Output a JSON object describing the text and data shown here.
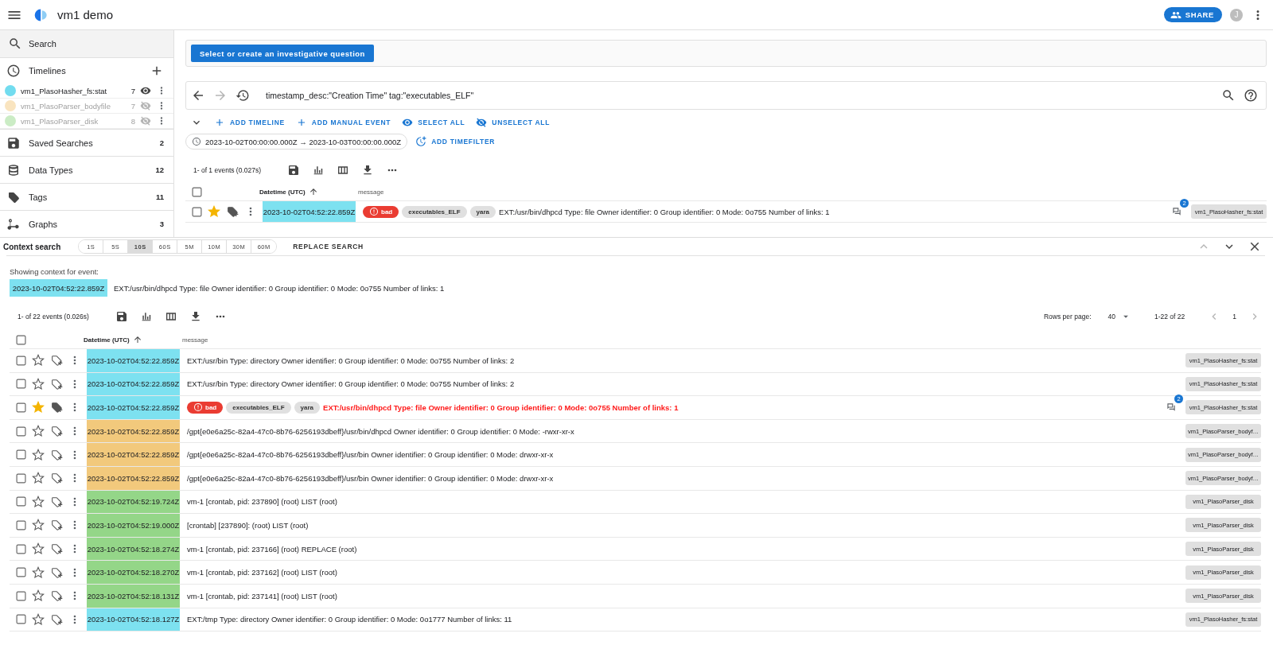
{
  "app_bar": {
    "title": "vm1 demo",
    "share_label": "SHARE",
    "avatar": "J"
  },
  "sidebar": {
    "search_label": "Search",
    "timelines_title": "Timelines",
    "timelines": [
      {
        "name": "vm1_PlasoHasher_fs:stat",
        "count": "7",
        "visible": true,
        "color": "#72dcef"
      },
      {
        "name": "vm1_PlasoParser_bodyfile",
        "count": "7",
        "visible": false,
        "color": "#f9e4bf"
      },
      {
        "name": "vm1_PlasoParser_disk",
        "count": "8",
        "visible": false,
        "color": "#cbecc5"
      }
    ],
    "sections": [
      {
        "label": "Saved Searches",
        "count": "2"
      },
      {
        "label": "Data Types",
        "count": "12"
      },
      {
        "label": "Tags",
        "count": "11"
      },
      {
        "label": "Graphs",
        "count": "3"
      }
    ]
  },
  "question": {
    "button_label": "Select or create an investigative question"
  },
  "search": {
    "query": "timestamp_desc:\"Creation Time\" tag:\"executables_ELF\""
  },
  "actions": [
    "ADD TIMELINE",
    "ADD MANUAL EVENT",
    "SELECT ALL",
    "UNSELECT ALL"
  ],
  "time_filter": {
    "range": "2023-10-02T00:00:00.000Z → 2023-10-03T00:00:00.000Z",
    "add_label": "ADD TIMEFILTER"
  },
  "results": {
    "summary": "1- of 1 events (0.027s)",
    "select_all_checked": false,
    "columns": [
      "Datetime (UTC)",
      "message"
    ],
    "rows": [
      {
        "checked": false,
        "starred": true,
        "datetime": "2023-10-02T04:52:22.859Z",
        "color": "#7de1f0",
        "tags": [
          {
            "label": "bad",
            "kind": "alert"
          },
          {
            "label": "executables_ELF",
            "kind": "label"
          },
          {
            "label": "yara",
            "kind": "label"
          }
        ],
        "message": "EXT:/usr/bin/dhpcd Type: file Owner identifier: 0 Group identifier: 0 Mode: 0o755 Number of links: 1",
        "highlighted": false,
        "comments": "2",
        "timeline": "vm1_PlasoHasher_fs:stat"
      }
    ]
  },
  "context": {
    "title": "Context search",
    "intervals": [
      {
        "label": "1S",
        "selected": false
      },
      {
        "label": "5S",
        "selected": false
      },
      {
        "label": "10S",
        "selected": true
      },
      {
        "label": "60S",
        "selected": false
      },
      {
        "label": "5M",
        "selected": false
      },
      {
        "label": "10M",
        "selected": false
      },
      {
        "label": "30M",
        "selected": false
      },
      {
        "label": "60M",
        "selected": false
      }
    ],
    "replace_label": "REPLACE SEARCH",
    "showing_label": "Showing context for event:",
    "event": {
      "datetime": "2023-10-02T04:52:22.859Z",
      "color": "#7de1f0",
      "message": "EXT:/usr/bin/dhpcd Type: file Owner identifier: 0 Group identifier: 0 Mode: 0o755 Number of links: 1"
    },
    "summary": "1- of 22 events (0.026s)",
    "select_all_checked": false,
    "rows_per_page_label": "Rows per page:",
    "rows_per_page": "40",
    "range": "1-22 of 22",
    "page": "1",
    "columns": [
      "Datetime (UTC)",
      "message"
    ],
    "rows": [
      {
        "checked": false,
        "starred": false,
        "datetime": "2023-10-02T04:52:22.859Z",
        "color": "#7de1f0",
        "tags": [],
        "message": "EXT:/usr/bin Type: directory Owner identifier: 0 Group identifier: 0 Mode: 0o755 Number of links: 2",
        "highlighted": false,
        "timeline": "vm1_PlasoHasher_fs:stat"
      },
      {
        "checked": false,
        "starred": false,
        "datetime": "2023-10-02T04:52:22.859Z",
        "color": "#7de1f0",
        "tags": [],
        "message": "EXT:/usr/bin Type: directory Owner identifier: 0 Group identifier: 0 Mode: 0o755 Number of links: 2",
        "highlighted": false,
        "timeline": "vm1_PlasoHasher_fs:stat"
      },
      {
        "checked": false,
        "starred": true,
        "datetime": "2023-10-02T04:52:22.859Z",
        "color": "#7de1f0",
        "tags": [
          {
            "label": "bad",
            "kind": "alert"
          },
          {
            "label": "executables_ELF",
            "kind": "label"
          },
          {
            "label": "yara",
            "kind": "label"
          }
        ],
        "message": "EXT:/usr/bin/dhpcd Type: file Owner identifier: 0 Group identifier: 0 Mode: 0o755 Number of links: 1",
        "highlighted": true,
        "comments": "2",
        "timeline": "vm1_PlasoHasher_fs:stat"
      },
      {
        "checked": false,
        "starred": false,
        "datetime": "2023-10-02T04:52:22.859Z",
        "color": "#f2c97c",
        "tags": [],
        "message": "/gpt{e0e6a25c-82a4-47c0-8b76-6256193dbeff}/usr/bin/dhpcd Owner identifier: 0 Group identifier: 0 Mode: -rwxr-xr-x",
        "highlighted": false,
        "timeline": "vm1_PlasoParser_bodyf…"
      },
      {
        "checked": false,
        "starred": false,
        "datetime": "2023-10-02T04:52:22.859Z",
        "color": "#f2c97c",
        "tags": [],
        "message": "/gpt{e0e6a25c-82a4-47c0-8b76-6256193dbeff}/usr/bin Owner identifier: 0 Group identifier: 0 Mode: drwxr-xr-x",
        "highlighted": false,
        "timeline": "vm1_PlasoParser_bodyf…"
      },
      {
        "checked": false,
        "starred": false,
        "datetime": "2023-10-02T04:52:22.859Z",
        "color": "#f2c97c",
        "tags": [],
        "message": "/gpt{e0e6a25c-82a4-47c0-8b76-6256193dbeff}/usr/bin Owner identifier: 0 Group identifier: 0 Mode: drwxr-xr-x",
        "highlighted": false,
        "timeline": "vm1_PlasoParser_bodyf…"
      },
      {
        "checked": false,
        "starred": false,
        "datetime": "2023-10-02T04:52:19.724Z",
        "color": "#94d688",
        "tags": [],
        "message": "vm-1 [crontab, pid: 237890] (root) LIST (root)",
        "highlighted": false,
        "timeline": "vm1_PlasoParser_disk"
      },
      {
        "checked": false,
        "starred": false,
        "datetime": "2023-10-02T04:52:19.000Z",
        "color": "#94d688",
        "tags": [],
        "message": "[crontab] [237890]: (root) LIST (root)",
        "highlighted": false,
        "timeline": "vm1_PlasoParser_disk"
      },
      {
        "checked": false,
        "starred": false,
        "datetime": "2023-10-02T04:52:18.274Z",
        "color": "#94d688",
        "tags": [],
        "message": "vm-1 [crontab, pid: 237166] (root) REPLACE (root)",
        "highlighted": false,
        "timeline": "vm1_PlasoParser_disk"
      },
      {
        "checked": false,
        "starred": false,
        "datetime": "2023-10-02T04:52:18.270Z",
        "color": "#94d688",
        "tags": [],
        "message": "vm-1 [crontab, pid: 237162] (root) LIST (root)",
        "highlighted": false,
        "timeline": "vm1_PlasoParser_disk"
      },
      {
        "checked": false,
        "starred": false,
        "datetime": "2023-10-02T04:52:18.131Z",
        "color": "#94d688",
        "tags": [],
        "message": "vm-1 [crontab, pid: 237141] (root) LIST (root)",
        "highlighted": false,
        "timeline": "vm1_PlasoParser_disk"
      },
      {
        "checked": false,
        "starred": false,
        "datetime": "2023-10-02T04:52:18.127Z",
        "color": "#7de1f0",
        "tags": [],
        "message": "EXT:/tmp Type: directory Owner identifier: 0 Group identifier: 0 Mode: 0o1777 Number of links: 11",
        "highlighted": false,
        "timeline": "vm1_PlasoHasher_fs:stat"
      }
    ]
  }
}
